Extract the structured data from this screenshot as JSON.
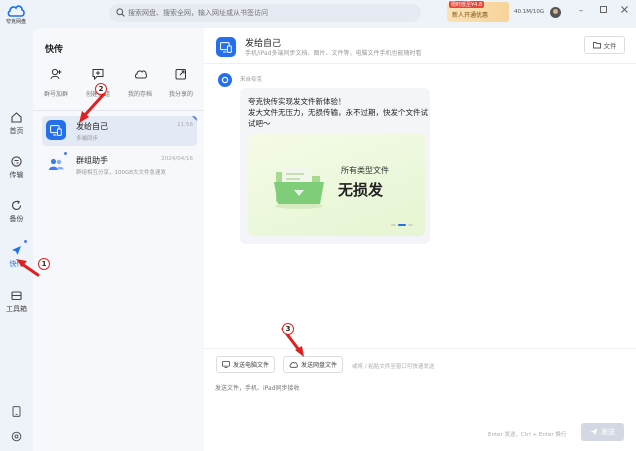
{
  "app": {
    "logo_text": "夸克网盘"
  },
  "search": {
    "placeholder": "搜索网盘、搜索全网，输入网址或从书签访问"
  },
  "promo": {
    "tag": "限时低至¥4.8",
    "text": "新人开通优惠"
  },
  "storage": {
    "text": "40.1M/10G"
  },
  "rail": {
    "items": [
      {
        "label": "首页"
      },
      {
        "label": "传输"
      },
      {
        "label": "备份"
      },
      {
        "label": "快传"
      },
      {
        "label": "工具箱"
      }
    ]
  },
  "panel": {
    "title": "快传",
    "quick_actions": [
      {
        "label": "群号加群"
      },
      {
        "label": "创建群组"
      },
      {
        "label": "我的存档"
      },
      {
        "label": "我分享的"
      }
    ],
    "conversations": [
      {
        "name": "发给自己",
        "subtitle": "多端同步",
        "time": "21:56"
      },
      {
        "name": "群组助手",
        "subtitle": "群组相互分享，100GB大文件急速发",
        "time": "2024/04/16"
      }
    ]
  },
  "chat": {
    "title": "发给自己",
    "subtitle": "手机/iPad多端同步文档、图片、文件等，电脑文件手机也能随时看",
    "file_button": "文件",
    "message": {
      "from": "来自夸克",
      "line1": "夸克快传实现发文件新体验！",
      "line2": "发大文件无压力，无损传输，永不过期，快发个文件试",
      "line3": "试吧～",
      "card_line1": "所有类型文件",
      "card_line2": "无损发"
    },
    "compose": {
      "btn_computer": "发送电脑文件",
      "btn_cloud": "发送网盘文件",
      "hint": "或将 / 粘贴文件至窗口可快速发送",
      "placeholder": "发送文件，手机、iPad同步接收",
      "send_hint": "Enter 发送，Ctrl + Enter 换行",
      "send_label": "发送"
    }
  },
  "annotations": [
    "1",
    "2",
    "3"
  ],
  "colors": {
    "accent": "#2470ea",
    "annotation": "#e02020"
  }
}
